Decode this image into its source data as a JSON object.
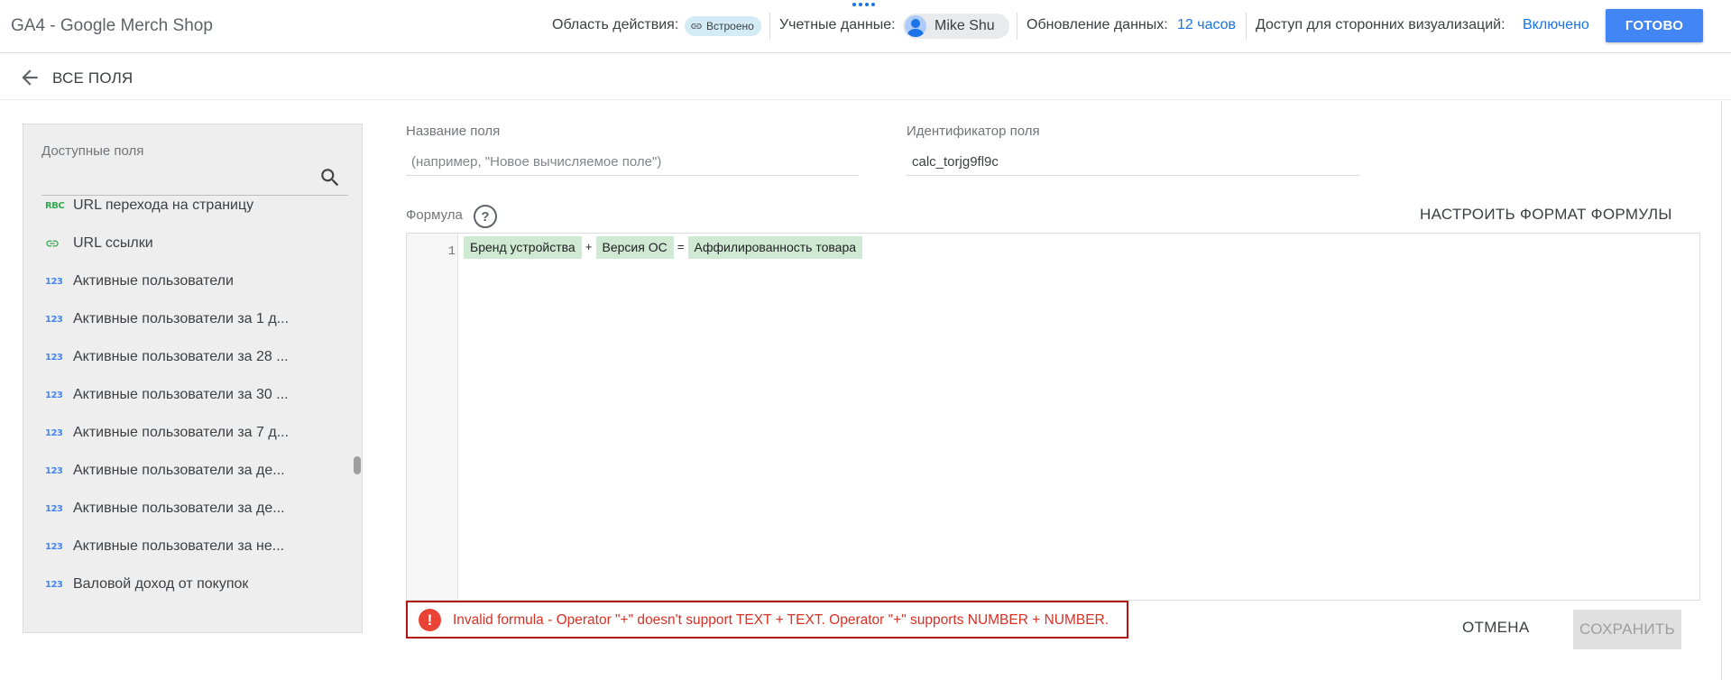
{
  "header": {
    "app_title": "GA4 - Google Merch Shop",
    "scope_label": "Область действия:",
    "scope_chip": "Встроено",
    "credentials_label": "Учетные данные:",
    "user_name": "Mike Shu",
    "refresh_label": "Обновление данных:",
    "refresh_value": "12 часов",
    "viz_label": "Доступ для сторонних визуализаций:",
    "viz_value": "Включено",
    "done_label": "ГОТОВО"
  },
  "subheader": {
    "back_label": "ВСЕ ПОЛЯ"
  },
  "left_panel": {
    "title": "Доступные поля",
    "fields": [
      {
        "icon": "RBC",
        "type": "txt",
        "label": "URL перехода на страницу"
      },
      {
        "icon": "link",
        "type": "link",
        "label": "URL ссылки"
      },
      {
        "icon": "123",
        "type": "num",
        "label": "Активные пользователи"
      },
      {
        "icon": "123",
        "type": "num",
        "label": "Активные пользователи за 1 д..."
      },
      {
        "icon": "123",
        "type": "num",
        "label": "Активные пользователи за 28 ..."
      },
      {
        "icon": "123",
        "type": "num",
        "label": "Активные пользователи за 30 ..."
      },
      {
        "icon": "123",
        "type": "num",
        "label": "Активные пользователи за 7 д..."
      },
      {
        "icon": "123",
        "type": "num",
        "label": "Активные пользователи за де..."
      },
      {
        "icon": "123",
        "type": "num",
        "label": "Активные пользователи за де..."
      },
      {
        "icon": "123",
        "type": "num",
        "label": "Активные пользователи за не..."
      },
      {
        "icon": "123",
        "type": "num",
        "label": "Валовой доход от покупок"
      }
    ]
  },
  "form": {
    "field_name_label": "Название поля",
    "field_name_placeholder": "(например, \"Новое вычисляемое поле\")",
    "field_id_label": "Идентификатор поля",
    "field_id_value": "calc_torjg9fl9c",
    "formula_label": "Формула",
    "format_button": "НАСТРОИТЬ ФОРМАТ ФОРМУЛЫ",
    "line_number": "1",
    "tokens": {
      "t1": "Бренд устройства",
      "op1": "+",
      "t2": "Версия ОС",
      "op2": "=",
      "t3": "Аффилированность товара"
    },
    "error_message": "Invalid formula - Operator \"+\" doesn't support TEXT + TEXT. Operator \"+\" supports NUMBER + NUMBER.",
    "cancel_label": "ОТМЕНА",
    "save_label": "СОХРАНИТЬ"
  },
  "icons": {
    "back": "arrow-back-icon",
    "search": "search-icon",
    "help": "help-icon",
    "error": "error-icon",
    "link": "link-icon"
  },
  "colors": {
    "accent": "#4285f4",
    "link": "#1a73e8",
    "token_bg": "#cfe9d2",
    "error": "#d93025",
    "error_border": "#b31412"
  }
}
